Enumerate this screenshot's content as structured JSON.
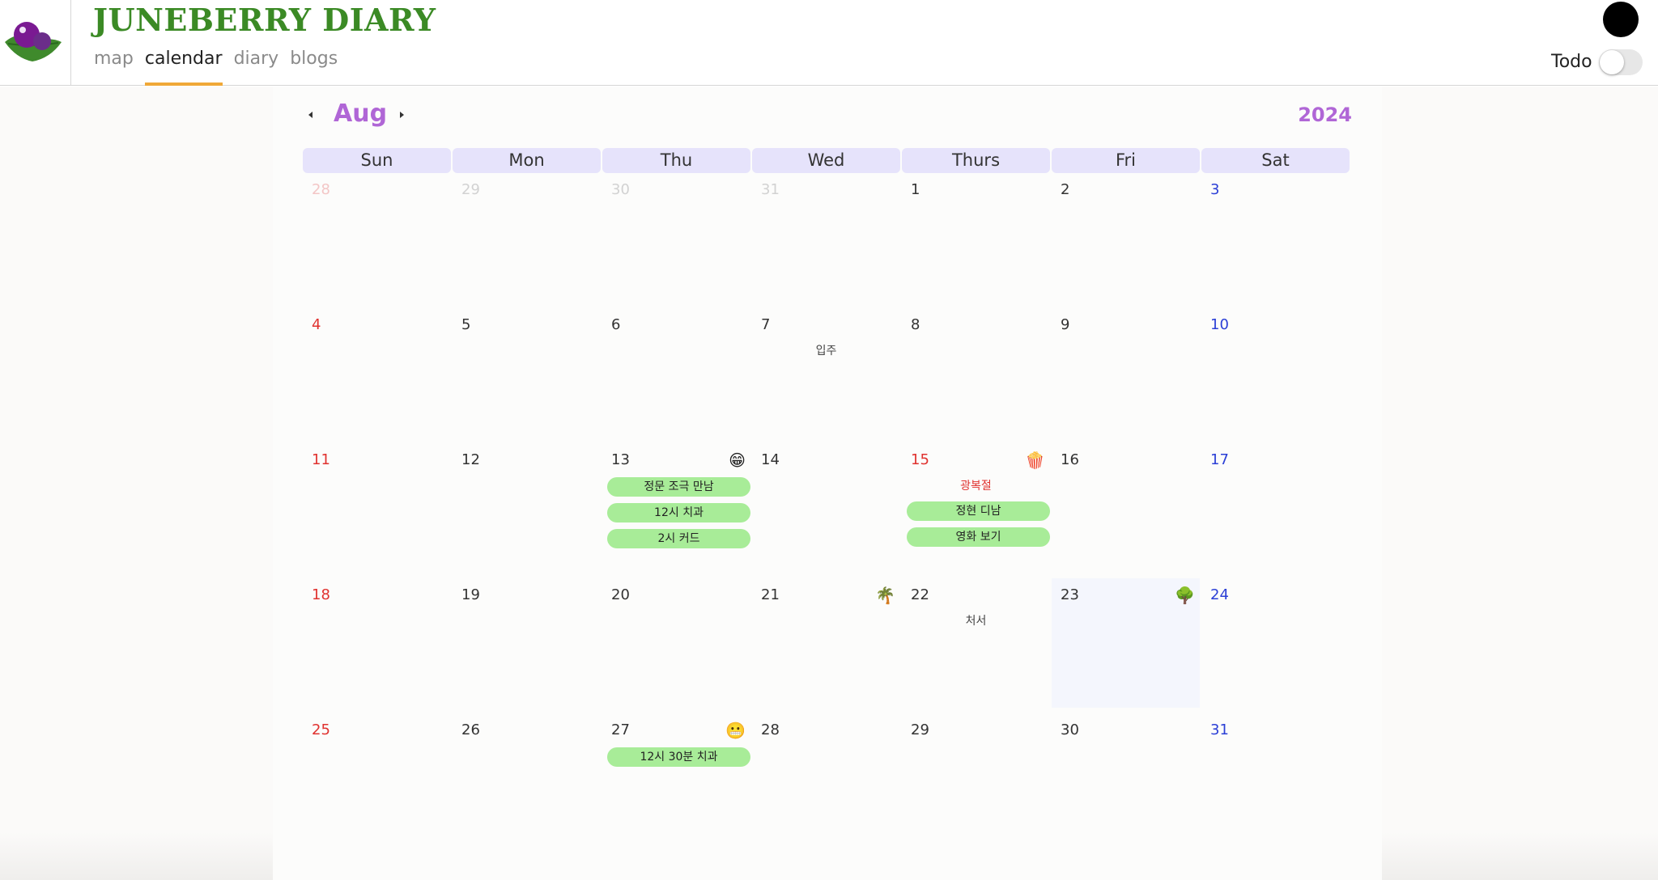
{
  "header": {
    "title": "JUNEBERRY DIARY",
    "nav": [
      {
        "label": "map",
        "active": false
      },
      {
        "label": "calendar",
        "active": true
      },
      {
        "label": "diary",
        "active": false
      },
      {
        "label": "blogs",
        "active": false
      }
    ],
    "todo_label": "Todo",
    "todo_on": false
  },
  "calendar": {
    "month": "Aug",
    "year": "2024",
    "weekdays": [
      "Sun",
      "Mon",
      "Thu",
      "Wed",
      "Thurs",
      "Fri",
      "Sat"
    ],
    "weeks": [
      [
        {
          "day": "28",
          "type": "other-sun"
        },
        {
          "day": "29",
          "type": "other"
        },
        {
          "day": "30",
          "type": "other"
        },
        {
          "day": "31",
          "type": "other"
        },
        {
          "day": "1"
        },
        {
          "day": "2"
        },
        {
          "day": "3",
          "type": "sat"
        }
      ],
      [
        {
          "day": "4",
          "type": "sun"
        },
        {
          "day": "5"
        },
        {
          "day": "6"
        },
        {
          "day": "7",
          "note": "입주"
        },
        {
          "day": "8"
        },
        {
          "day": "9"
        },
        {
          "day": "10",
          "type": "sat"
        }
      ],
      [
        {
          "day": "11",
          "type": "sun"
        },
        {
          "day": "12"
        },
        {
          "day": "13",
          "icon": "😁",
          "icon_name": "grinning-face-icon",
          "events": [
            "정문 조극 만남",
            "12시 치과",
            "2시 커드"
          ]
        },
        {
          "day": "14"
        },
        {
          "day": "15",
          "type": "sun",
          "icon": "🍿",
          "icon_name": "popcorn-icon",
          "holiday": "광복절",
          "events": [
            "정현 디남",
            "영화 보기"
          ]
        },
        {
          "day": "16"
        },
        {
          "day": "17",
          "type": "sat"
        }
      ],
      [
        {
          "day": "18",
          "type": "sun"
        },
        {
          "day": "19"
        },
        {
          "day": "20"
        },
        {
          "day": "21",
          "icon": "🌴",
          "icon_name": "palm-tree-icon"
        },
        {
          "day": "22",
          "note": "처서"
        },
        {
          "day": "23",
          "today": true,
          "icon": "🌳",
          "icon_name": "tree-icon"
        },
        {
          "day": "24",
          "type": "sat"
        }
      ],
      [
        {
          "day": "25",
          "type": "sun"
        },
        {
          "day": "26"
        },
        {
          "day": "27",
          "icon": "😬",
          "icon_name": "grimacing-face-icon",
          "events": [
            "12시 30분 치과"
          ]
        },
        {
          "day": "28"
        },
        {
          "day": "29"
        },
        {
          "day": "30"
        },
        {
          "day": "31",
          "type": "sat"
        }
      ]
    ]
  },
  "colors": {
    "title_green": "#3b8a25",
    "accent_purple": "#b066d6",
    "weekday_bg": "#e6e3fb",
    "event_green": "#a8ec98",
    "sunday_red": "#e0322f",
    "saturday_blue": "#2b3fd6",
    "tab_underline": "#f0a838"
  }
}
